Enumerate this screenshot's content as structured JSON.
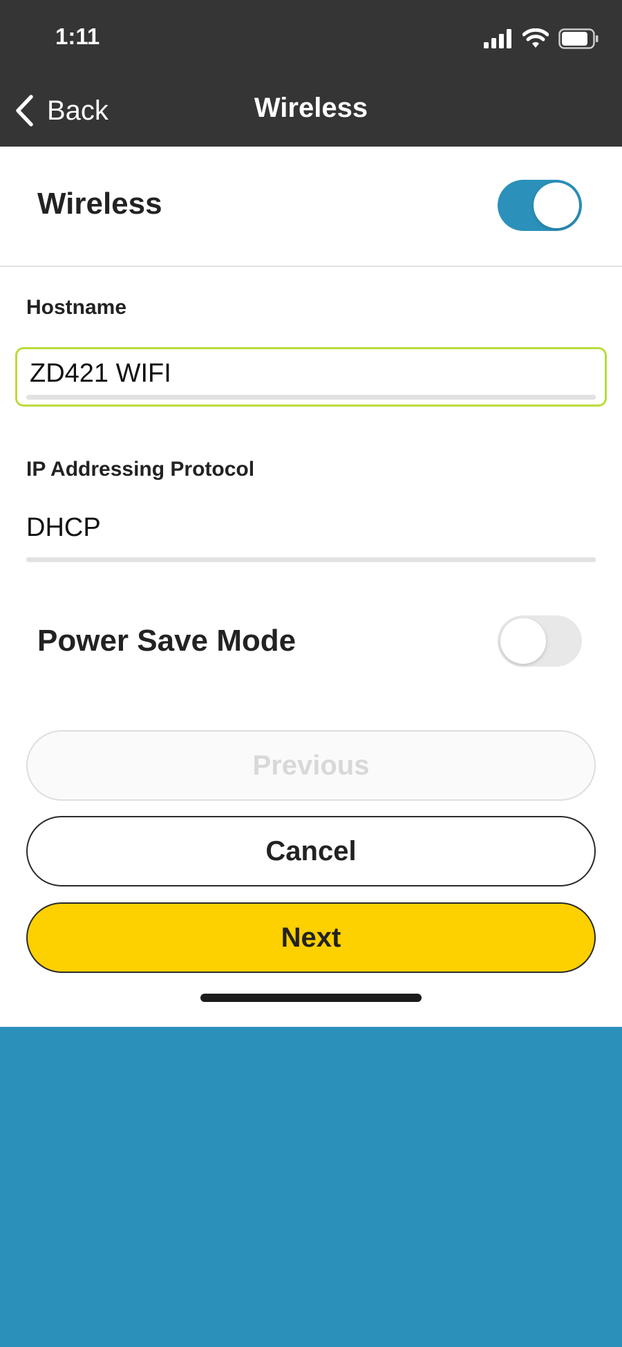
{
  "status_bar": {
    "time": "1:11"
  },
  "nav": {
    "back_label": "Back",
    "title": "Wireless"
  },
  "wireless_row": {
    "label": "Wireless",
    "enabled": true
  },
  "hostname": {
    "label": "Hostname",
    "value": "ZD421 WIFI"
  },
  "ip_protocol": {
    "label": "IP Addressing Protocol",
    "value": "DHCP"
  },
  "power_save": {
    "label": "Power Save Mode",
    "enabled": false
  },
  "buttons": {
    "previous": "Previous",
    "cancel": "Cancel",
    "next": "Next"
  },
  "colors": {
    "header": "#353535",
    "toggle_on": "#2b91ba",
    "accent_focus": "#b9dc3a",
    "next_button": "#fdd000",
    "footer": "#2b91ba"
  },
  "icons": {
    "back": "chevron-left-icon",
    "signal": "cellular-signal-icon",
    "wifi": "wifi-icon",
    "battery": "battery-icon"
  }
}
